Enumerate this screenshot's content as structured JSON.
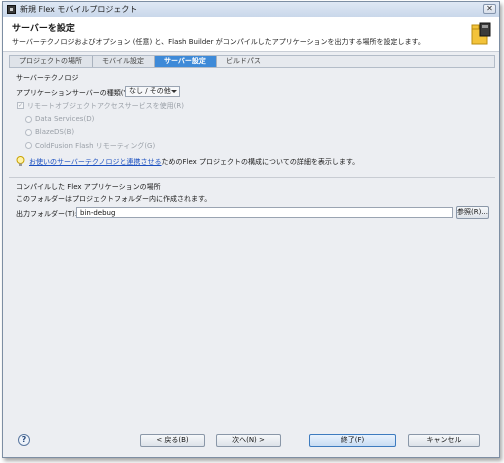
{
  "window": {
    "title": "新規 Flex モバイルプロジェクト",
    "close_glyph": "✕"
  },
  "header": {
    "title": "サーバーを設定",
    "description": "サーバーテクノロジおよびオプション (任意) と、Flash Builder がコンパイルしたアプリケーションを出力する場所を設定します。",
    "graphic_icon": "folder-wizard-icon"
  },
  "steps": [
    {
      "label": "プロジェクトの場所"
    },
    {
      "label": "モバイル設定"
    },
    {
      "label": "サーバー設定"
    },
    {
      "label": "ビルドパス"
    }
  ],
  "server": {
    "section_label": "サーバーテクノロジ",
    "type_label": "アプリケーションサーバーの種類(Y):",
    "type_value": "なし / その他",
    "remote_access_label": "リモートオブジェクトアクセスサービスを使用(R)",
    "options": [
      {
        "label": "Data Services(D)"
      },
      {
        "label": "BlazeDS(B)"
      },
      {
        "label": "ColdFusion Flash リモーティング(G)"
      }
    ]
  },
  "info": {
    "link_text": "お使いのサーバーテクノロジと連携させる",
    "rest_text": "ためのFlex プロジェクトの構成についての詳細を表示します。"
  },
  "output": {
    "section_label": "コンパイルした Flex アプリケーションの場所",
    "hint": "このフォルダーはプロジェクトフォルダー内に作成されます。",
    "folder_label": "出力フォルダー(T):",
    "folder_value": "bin-debug",
    "browse_label": "参照(R)..."
  },
  "buttons": {
    "help": "?",
    "back": "< 戻る(B)",
    "next": "次へ(N) >",
    "finish": "終了(F)",
    "cancel": "キャンセル"
  },
  "colors": {
    "active_step": "#3e8ad8",
    "link": "#1a4fc0"
  }
}
